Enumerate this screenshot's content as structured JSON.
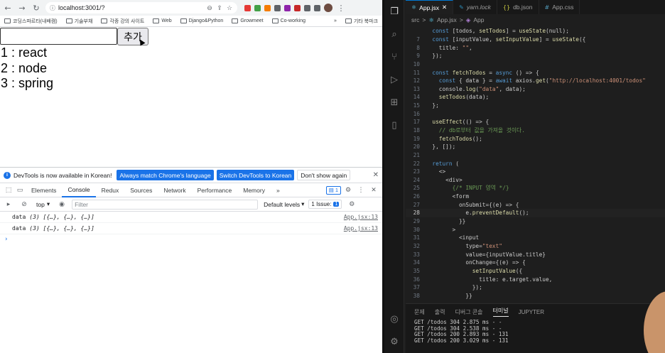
{
  "browser": {
    "url": "localhost:3001/?",
    "bookmarks": [
      "코딩스파르타(내배캠)",
      "기술부채",
      "각종 강의 사이트",
      "Web",
      "Django&Python",
      "Growmeet",
      "Co-working"
    ],
    "bookmarks_more": "»",
    "other_bookmarks": "기타 북마크",
    "page": {
      "input_value": "",
      "add_button": "추가",
      "todos": [
        "1 : react",
        "2 : node",
        "3 : spring"
      ]
    }
  },
  "devtools": {
    "banner_text": "DevTools is now available in Korean!",
    "banner_btn_1": "Always match Chrome's language",
    "banner_btn_2": "Switch DevTools to Korean",
    "banner_btn_3": "Don't show again",
    "tabs": [
      "Elements",
      "Console",
      "Redux",
      "Sources",
      "Network",
      "Performance",
      "Memory"
    ],
    "more_tabs": "»",
    "issue_count": "1",
    "context": "top",
    "filter_placeholder": "Filter",
    "levels": "Default levels",
    "issues_label": "1 Issue:",
    "issues_num": "1",
    "logs": [
      {
        "label": "data",
        "value": "(3) [{…}, {…}, {…}]",
        "source": "App.jsx:13"
      },
      {
        "label": "data",
        "value": "(3) [{…}, {…}, {…}]",
        "source": "App.jsx:13"
      }
    ],
    "prompt": "›"
  },
  "vscode": {
    "tabs": [
      {
        "icon": "⚛",
        "label": "App.jsx"
      },
      {
        "icon": "✎",
        "label": "yarn.lock"
      },
      {
        "icon": "{}",
        "label": "db.json"
      },
      {
        "icon": "#",
        "label": "App.css"
      }
    ],
    "breadcrumbs": [
      "src",
      ">",
      "App.jsx",
      ">",
      "App"
    ],
    "code": [
      {
        "n": "",
        "t": "  const [todos, setTodos] = useState(null);"
      },
      {
        "n": "7",
        "t": "  const [inputValue, setInputValue] = useState({"
      },
      {
        "n": "8",
        "t": "    title: \"\","
      },
      {
        "n": "9",
        "t": "  });"
      },
      {
        "n": "10",
        "t": ""
      },
      {
        "n": "11",
        "t": "  const fetchTodos = async () => {"
      },
      {
        "n": "12",
        "t": "    const { data } = await axios.get(\"http://localhost:4001/todos\""
      },
      {
        "n": "13",
        "t": "    console.log(\"data\", data);"
      },
      {
        "n": "14",
        "t": "    setTodos(data);"
      },
      {
        "n": "15",
        "t": "  };"
      },
      {
        "n": "16",
        "t": ""
      },
      {
        "n": "17",
        "t": "  useEffect(() => {"
      },
      {
        "n": "18",
        "t": "    // db로부터 값을 가져올 것이다."
      },
      {
        "n": "19",
        "t": "    fetchTodos();"
      },
      {
        "n": "20",
        "t": "  }, []);"
      },
      {
        "n": "21",
        "t": ""
      },
      {
        "n": "22",
        "t": "  return ("
      },
      {
        "n": "23",
        "t": "    <>"
      },
      {
        "n": "24",
        "t": "      <div>"
      },
      {
        "n": "25",
        "t": "        {/* INPUT 영역 */}"
      },
      {
        "n": "26",
        "t": "        <form"
      },
      {
        "n": "27",
        "t": "          onSubmit={(e) => {"
      },
      {
        "n": "28",
        "t": "            e.preventDefault();"
      },
      {
        "n": "29",
        "t": "          }}"
      },
      {
        "n": "30",
        "t": "        >"
      },
      {
        "n": "31",
        "t": "          <input"
      },
      {
        "n": "32",
        "t": "            type=\"text\""
      },
      {
        "n": "33",
        "t": "            value={inputValue.title}"
      },
      {
        "n": "34",
        "t": "            onChange={(e) => {"
      },
      {
        "n": "35",
        "t": "              setInputValue({"
      },
      {
        "n": "36",
        "t": "                title: e.target.value,"
      },
      {
        "n": "37",
        "t": "              });"
      },
      {
        "n": "38",
        "t": "            }}"
      }
    ],
    "current_line": "28",
    "panel_tabs": [
      "문제",
      "출력",
      "디버그 콘솔",
      "터미널",
      "JUPYTER"
    ],
    "active_panel_tab": "터미널",
    "terminal": [
      "GET /todos 304 2.875 ms - -",
      "GET /todos 304 2.538 ms - -",
      "GET /todos 200 2.893 ms - 131",
      "GET /todos 200 3.029 ms - 131"
    ]
  }
}
